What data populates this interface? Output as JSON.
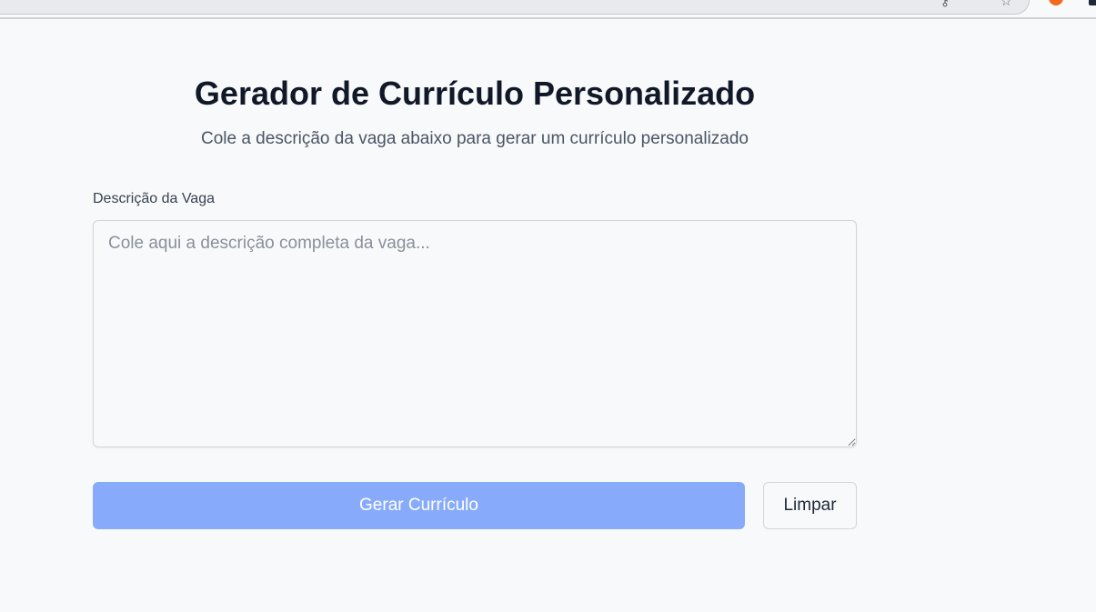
{
  "browser": {
    "key_icon": "key-icon",
    "star_icon": "star-icon"
  },
  "header": {
    "title": "Gerador de Currículo Personalizado",
    "subtitle": "Cole a descrição da vaga abaixo para gerar um currículo personalizado"
  },
  "form": {
    "job_description_label": "Descrição da Vaga",
    "job_description_value": "",
    "job_description_placeholder": "Cole aqui a descrição completa da vaga..."
  },
  "actions": {
    "generate_label": "Gerar Currículo",
    "clear_label": "Limpar"
  },
  "colors": {
    "primary_button": "#87abfa",
    "background": "#f8f9fb"
  }
}
